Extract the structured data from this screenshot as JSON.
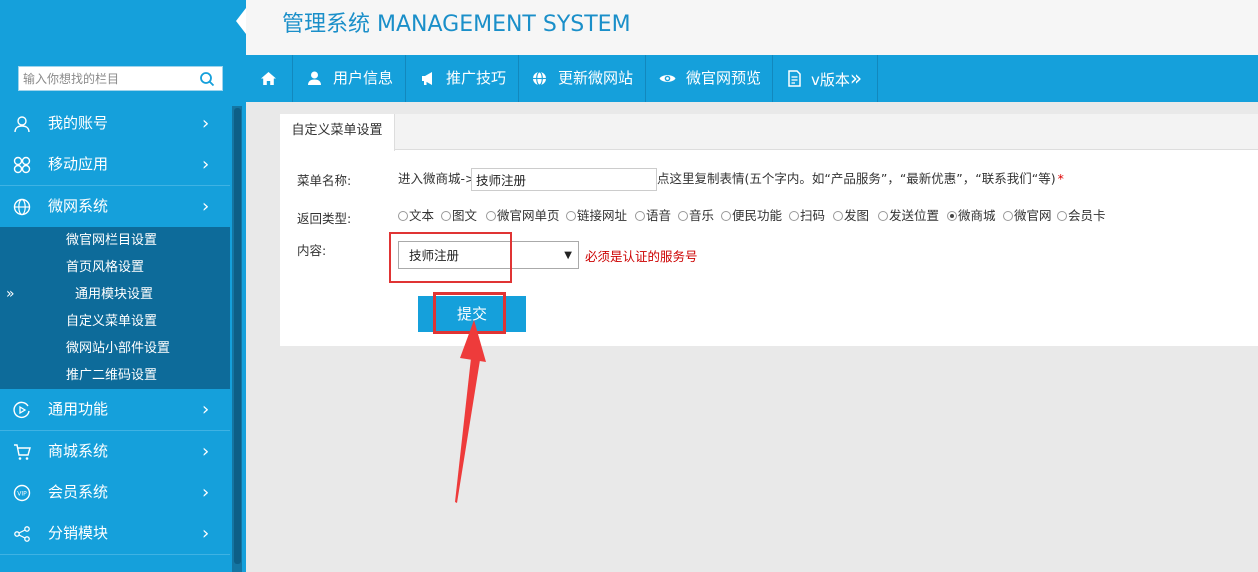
{
  "app": {
    "title": "管理系统 MANAGEMENT SYSTEM"
  },
  "search": {
    "placeholder": "输入你想找的栏目",
    "icon": "search-icon"
  },
  "sidebar": {
    "items": [
      {
        "label": "我的账号",
        "icon": "user-icon"
      },
      {
        "label": "移动应用",
        "icon": "apps-icon"
      },
      {
        "label": "微网系统",
        "icon": "globe-icon"
      },
      {
        "label": "通用功能",
        "icon": "play-circle-icon"
      },
      {
        "label": "商城系统",
        "icon": "cart-icon"
      },
      {
        "label": "会员系统",
        "icon": "vip-icon"
      },
      {
        "label": "分销模块",
        "icon": "share-icon"
      }
    ],
    "chevron": "›",
    "submenu": [
      "微官网栏目设置",
      "首页风格设置",
      "通用模块设置",
      "自定义菜单设置",
      "微网站小部件设置",
      "推广二维码设置"
    ],
    "active_marker": "»"
  },
  "topnav": {
    "items": [
      {
        "label": "",
        "icon": "home-icon"
      },
      {
        "label": "用户信息",
        "icon": "user-icon"
      },
      {
        "label": "推广技巧",
        "icon": "megaphone-icon"
      },
      {
        "label": "更新微网站",
        "icon": "globe-icon"
      },
      {
        "label": "微官网预览",
        "icon": "eye-icon"
      },
      {
        "label": "v版本",
        "icon": "document-icon",
        "suffix": "»"
      }
    ]
  },
  "panel": {
    "tab": "自定义菜单设置",
    "menu_name_label": "菜单名称:",
    "menu_name_prefix": "进入微商城->",
    "menu_name_value": "技师注册",
    "menu_name_hint": "点这里复制表情(五个字内。如“产品服务”，“最新优惠”，“联系我们“等)",
    "required_mark": "*",
    "return_type_label": "返回类型:",
    "return_types": [
      {
        "label": "文本",
        "checked": false
      },
      {
        "label": "图文",
        "checked": false
      },
      {
        "label": "微官网单页",
        "checked": false
      },
      {
        "label": "链接网址",
        "checked": false
      },
      {
        "label": "语音",
        "checked": false
      },
      {
        "label": "音乐",
        "checked": false
      },
      {
        "label": "便民功能",
        "checked": false
      },
      {
        "label": "扫码",
        "checked": false
      },
      {
        "label": "发图",
        "checked": false
      },
      {
        "label": "发送位置",
        "checked": false
      },
      {
        "label": "微商城",
        "checked": true
      },
      {
        "label": "微官网",
        "checked": false
      },
      {
        "label": "会员卡",
        "checked": false
      }
    ],
    "content_label": "内容:",
    "content_value": "技师注册",
    "content_hint": "必须是认证的服务号",
    "submit_label": "提交"
  },
  "colors": {
    "brand": "#15a0db",
    "submenu_bg": "#0d6b9a",
    "annotation": "#e03434"
  }
}
